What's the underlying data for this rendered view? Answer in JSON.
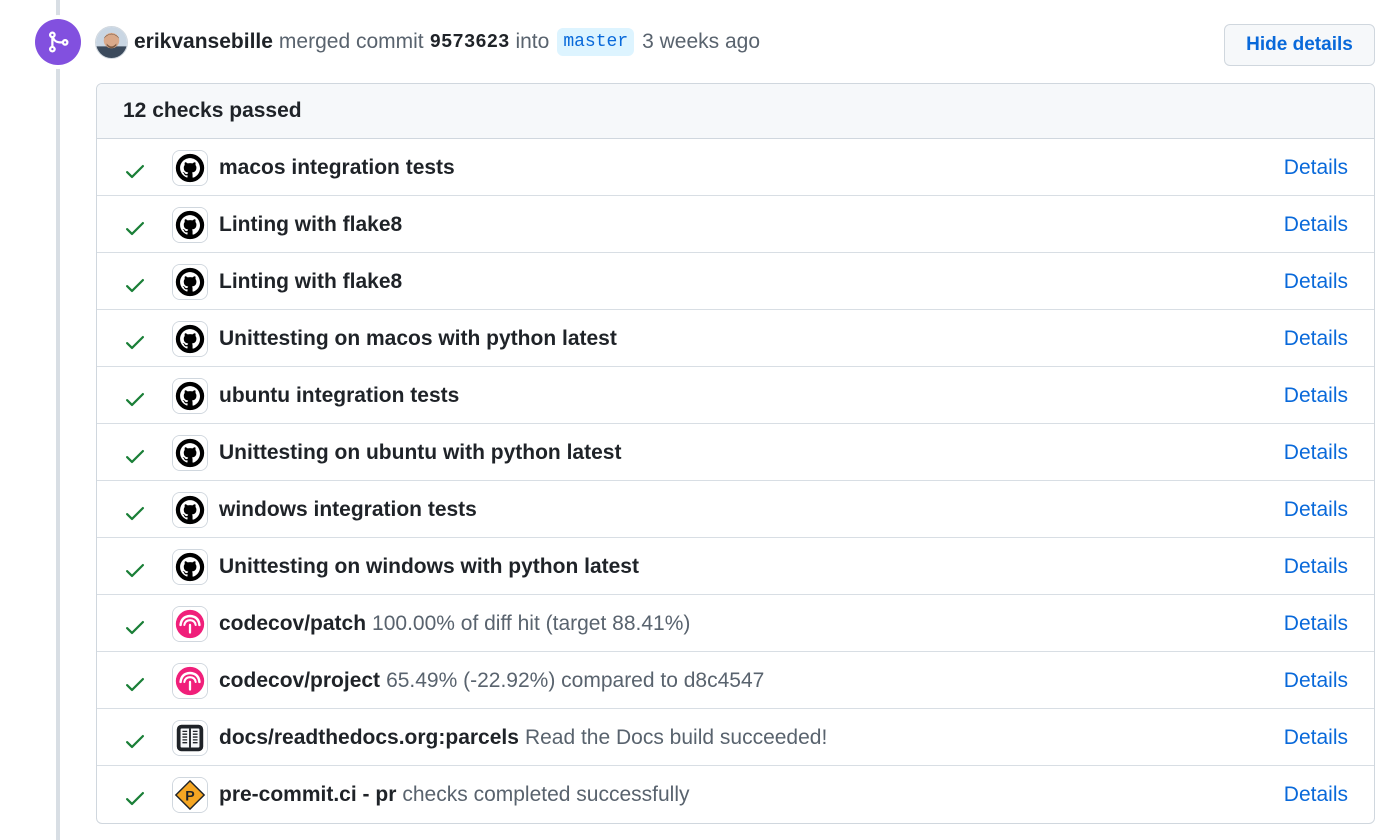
{
  "event": {
    "author": "erikvansebille",
    "action": "merged commit",
    "commit_sha": "9573623",
    "into_word": "into",
    "branch": "master",
    "time_ago": "3 weeks ago",
    "hide_details_label": "Hide details"
  },
  "checks": {
    "summary": "12 checks passed",
    "details_label": "Details",
    "status_color": "#1a7f37",
    "items": [
      {
        "name": "macos integration tests",
        "description": "",
        "app_icon": "github-icon"
      },
      {
        "name": "Linting with flake8",
        "description": "",
        "app_icon": "github-icon"
      },
      {
        "name": "Linting with flake8",
        "description": "",
        "app_icon": "github-icon"
      },
      {
        "name": "Unittesting on macos with python latest",
        "description": "",
        "app_icon": "github-icon"
      },
      {
        "name": "ubuntu integration tests",
        "description": "",
        "app_icon": "github-icon"
      },
      {
        "name": "Unittesting on ubuntu with python latest",
        "description": "",
        "app_icon": "github-icon"
      },
      {
        "name": "windows integration tests",
        "description": "",
        "app_icon": "github-icon"
      },
      {
        "name": "Unittesting on windows with python latest",
        "description": "",
        "app_icon": "github-icon"
      },
      {
        "name": "codecov/patch",
        "description": "100.00% of diff hit (target 88.41%)",
        "app_icon": "codecov-icon"
      },
      {
        "name": "codecov/project",
        "description": "65.49% (-22.92%) compared to d8c4547",
        "app_icon": "codecov-icon"
      },
      {
        "name": "docs/readthedocs.org:parcels",
        "description": "Read the Docs build succeeded!",
        "app_icon": "readthedocs-icon"
      },
      {
        "name": "pre-commit.ci - pr",
        "description": "checks completed successfully",
        "app_icon": "precommit-icon"
      }
    ]
  },
  "colors": {
    "merge_badge": "#8250df",
    "link": "#0969da",
    "codecov": "#f01f7a",
    "precommit": "#f5a623"
  }
}
